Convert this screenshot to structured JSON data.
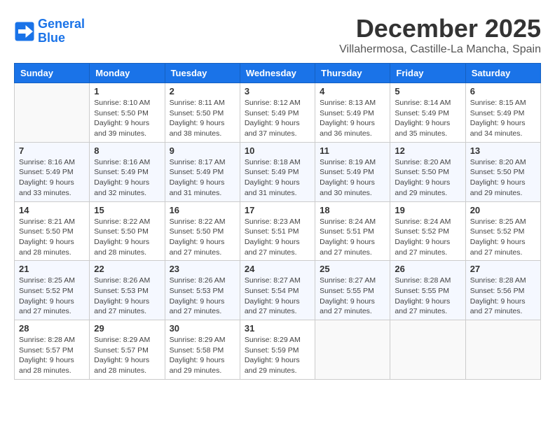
{
  "header": {
    "logo_line1": "General",
    "logo_line2": "Blue",
    "title": "December 2025",
    "subtitle": "Villahermosa, Castille-La Mancha, Spain"
  },
  "calendar": {
    "days_of_week": [
      "Sunday",
      "Monday",
      "Tuesday",
      "Wednesday",
      "Thursday",
      "Friday",
      "Saturday"
    ],
    "weeks": [
      [
        {
          "day": "",
          "info": ""
        },
        {
          "day": "1",
          "info": "Sunrise: 8:10 AM\nSunset: 5:50 PM\nDaylight: 9 hours\nand 39 minutes."
        },
        {
          "day": "2",
          "info": "Sunrise: 8:11 AM\nSunset: 5:50 PM\nDaylight: 9 hours\nand 38 minutes."
        },
        {
          "day": "3",
          "info": "Sunrise: 8:12 AM\nSunset: 5:49 PM\nDaylight: 9 hours\nand 37 minutes."
        },
        {
          "day": "4",
          "info": "Sunrise: 8:13 AM\nSunset: 5:49 PM\nDaylight: 9 hours\nand 36 minutes."
        },
        {
          "day": "5",
          "info": "Sunrise: 8:14 AM\nSunset: 5:49 PM\nDaylight: 9 hours\nand 35 minutes."
        },
        {
          "day": "6",
          "info": "Sunrise: 8:15 AM\nSunset: 5:49 PM\nDaylight: 9 hours\nand 34 minutes."
        }
      ],
      [
        {
          "day": "7",
          "info": "Sunrise: 8:16 AM\nSunset: 5:49 PM\nDaylight: 9 hours\nand 33 minutes."
        },
        {
          "day": "8",
          "info": "Sunrise: 8:16 AM\nSunset: 5:49 PM\nDaylight: 9 hours\nand 32 minutes."
        },
        {
          "day": "9",
          "info": "Sunrise: 8:17 AM\nSunset: 5:49 PM\nDaylight: 9 hours\nand 31 minutes."
        },
        {
          "day": "10",
          "info": "Sunrise: 8:18 AM\nSunset: 5:49 PM\nDaylight: 9 hours\nand 31 minutes."
        },
        {
          "day": "11",
          "info": "Sunrise: 8:19 AM\nSunset: 5:49 PM\nDaylight: 9 hours\nand 30 minutes."
        },
        {
          "day": "12",
          "info": "Sunrise: 8:20 AM\nSunset: 5:50 PM\nDaylight: 9 hours\nand 29 minutes."
        },
        {
          "day": "13",
          "info": "Sunrise: 8:20 AM\nSunset: 5:50 PM\nDaylight: 9 hours\nand 29 minutes."
        }
      ],
      [
        {
          "day": "14",
          "info": "Sunrise: 8:21 AM\nSunset: 5:50 PM\nDaylight: 9 hours\nand 28 minutes."
        },
        {
          "day": "15",
          "info": "Sunrise: 8:22 AM\nSunset: 5:50 PM\nDaylight: 9 hours\nand 28 minutes."
        },
        {
          "day": "16",
          "info": "Sunrise: 8:22 AM\nSunset: 5:50 PM\nDaylight: 9 hours\nand 27 minutes."
        },
        {
          "day": "17",
          "info": "Sunrise: 8:23 AM\nSunset: 5:51 PM\nDaylight: 9 hours\nand 27 minutes."
        },
        {
          "day": "18",
          "info": "Sunrise: 8:24 AM\nSunset: 5:51 PM\nDaylight: 9 hours\nand 27 minutes."
        },
        {
          "day": "19",
          "info": "Sunrise: 8:24 AM\nSunset: 5:52 PM\nDaylight: 9 hours\nand 27 minutes."
        },
        {
          "day": "20",
          "info": "Sunrise: 8:25 AM\nSunset: 5:52 PM\nDaylight: 9 hours\nand 27 minutes."
        }
      ],
      [
        {
          "day": "21",
          "info": "Sunrise: 8:25 AM\nSunset: 5:52 PM\nDaylight: 9 hours\nand 27 minutes."
        },
        {
          "day": "22",
          "info": "Sunrise: 8:26 AM\nSunset: 5:53 PM\nDaylight: 9 hours\nand 27 minutes."
        },
        {
          "day": "23",
          "info": "Sunrise: 8:26 AM\nSunset: 5:53 PM\nDaylight: 9 hours\nand 27 minutes."
        },
        {
          "day": "24",
          "info": "Sunrise: 8:27 AM\nSunset: 5:54 PM\nDaylight: 9 hours\nand 27 minutes."
        },
        {
          "day": "25",
          "info": "Sunrise: 8:27 AM\nSunset: 5:55 PM\nDaylight: 9 hours\nand 27 minutes."
        },
        {
          "day": "26",
          "info": "Sunrise: 8:28 AM\nSunset: 5:55 PM\nDaylight: 9 hours\nand 27 minutes."
        },
        {
          "day": "27",
          "info": "Sunrise: 8:28 AM\nSunset: 5:56 PM\nDaylight: 9 hours\nand 27 minutes."
        }
      ],
      [
        {
          "day": "28",
          "info": "Sunrise: 8:28 AM\nSunset: 5:57 PM\nDaylight: 9 hours\nand 28 minutes."
        },
        {
          "day": "29",
          "info": "Sunrise: 8:29 AM\nSunset: 5:57 PM\nDaylight: 9 hours\nand 28 minutes."
        },
        {
          "day": "30",
          "info": "Sunrise: 8:29 AM\nSunset: 5:58 PM\nDaylight: 9 hours\nand 29 minutes."
        },
        {
          "day": "31",
          "info": "Sunrise: 8:29 AM\nSunset: 5:59 PM\nDaylight: 9 hours\nand 29 minutes."
        },
        {
          "day": "",
          "info": ""
        },
        {
          "day": "",
          "info": ""
        },
        {
          "day": "",
          "info": ""
        }
      ]
    ]
  }
}
